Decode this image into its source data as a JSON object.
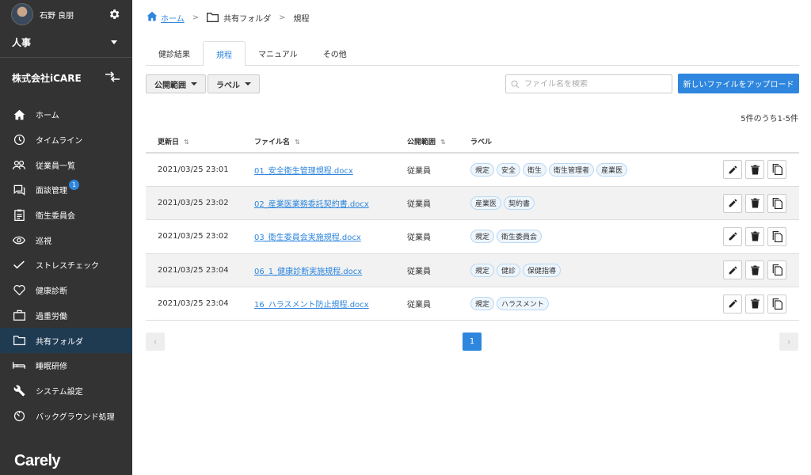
{
  "sidebar": {
    "user_name": "石野 良朋",
    "department": "人事",
    "company": "株式会社iCARE",
    "items": [
      {
        "label": "ホーム",
        "icon": "home-icon"
      },
      {
        "label": "タイムライン",
        "icon": "clock-icon"
      },
      {
        "label": "従業員一覧",
        "icon": "people-icon"
      },
      {
        "label": "面談管理",
        "icon": "chat-icon",
        "badge": "1"
      },
      {
        "label": "衛生委員会",
        "icon": "clipboard-icon"
      },
      {
        "label": "巡視",
        "icon": "eye-icon"
      },
      {
        "label": "ストレスチェック",
        "icon": "check-icon"
      },
      {
        "label": "健康診断",
        "icon": "heart-icon"
      },
      {
        "label": "過重労働",
        "icon": "briefcase-icon"
      },
      {
        "label": "共有フォルダ",
        "icon": "folder-icon",
        "active": true
      },
      {
        "label": "睡眠研修",
        "icon": "bed-icon"
      },
      {
        "label": "システム設定",
        "icon": "wrench-icon"
      },
      {
        "label": "バックグラウンド処理",
        "icon": "timer-icon"
      }
    ],
    "logo": "Carely"
  },
  "breadcrumb": {
    "home": "ホーム",
    "folder": "共有フォルダ",
    "current": "規程"
  },
  "tabs": [
    "健診結果",
    "規程",
    "マニュアル",
    "その他"
  ],
  "filters": {
    "scope": "公開範囲",
    "label": "ラベル"
  },
  "search": {
    "placeholder": "ファイル名を検索"
  },
  "upload_label": "新しいファイルをアップロード",
  "count_text": "5件のうち1-5件",
  "table": {
    "headers": {
      "updated": "更新日",
      "filename": "ファイル名",
      "scope": "公開範囲",
      "labels": "ラベル"
    },
    "rows": [
      {
        "date": "2021/03/25 23:01",
        "file": "01_安全衛生管理規程.docx",
        "scope": "従業員",
        "labels": [
          "規定",
          "安全",
          "衛生",
          "衛生管理者",
          "産業医"
        ]
      },
      {
        "date": "2021/03/25 23:02",
        "file": "02_産業医業務委託契約書.docx",
        "scope": "従業員",
        "labels": [
          "産業医",
          "契約書"
        ]
      },
      {
        "date": "2021/03/25 23:02",
        "file": "03_衛生委員会実施規程.docx",
        "scope": "従業員",
        "labels": [
          "規定",
          "衛生委員会"
        ]
      },
      {
        "date": "2021/03/25 23:04",
        "file": "06_1_健康診断実施規程.docx",
        "scope": "従業員",
        "labels": [
          "規定",
          "健診",
          "保健指導"
        ]
      },
      {
        "date": "2021/03/25 23:04",
        "file": "16_ハラスメント防止規程.docx",
        "scope": "従業員",
        "labels": [
          "規定",
          "ハラスメント"
        ]
      }
    ]
  },
  "pagination": {
    "current": "1",
    "prev": "‹",
    "next": "›"
  },
  "colors": {
    "sidebar": "#333333",
    "active": "#1f3b52",
    "accent": "#2e86de"
  }
}
